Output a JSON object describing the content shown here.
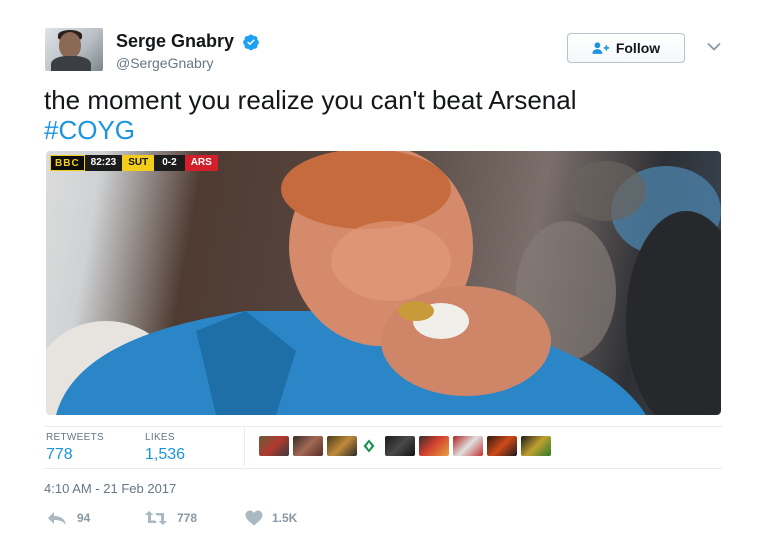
{
  "user": {
    "display_name": "Serge Gnabry",
    "handle": "@SergeGnabry",
    "avatar_icon": "profile-photo"
  },
  "follow_button": {
    "label": "Follow",
    "icon": "user-plus-icon"
  },
  "tweet": {
    "text": "the moment you realize you can't beat Arsenal",
    "hashtag": "#COYG"
  },
  "media": {
    "scorebug": {
      "channel": "BBC",
      "clock": "82:23",
      "home": "SUT",
      "score": "0-2",
      "away": "ARS"
    }
  },
  "stats": {
    "retweets_label": "RETWEETS",
    "retweets_value": "778",
    "likes_label": "LIKES",
    "likes_value": "1,536"
  },
  "timestamp": "4:10 AM - 21 Feb 2017",
  "actions": {
    "reply_count": "94",
    "retweet_count": "778",
    "like_count": "1.5K"
  },
  "colors": {
    "link": "#1b95e0",
    "muted": "#657786",
    "text": "#14171a"
  }
}
